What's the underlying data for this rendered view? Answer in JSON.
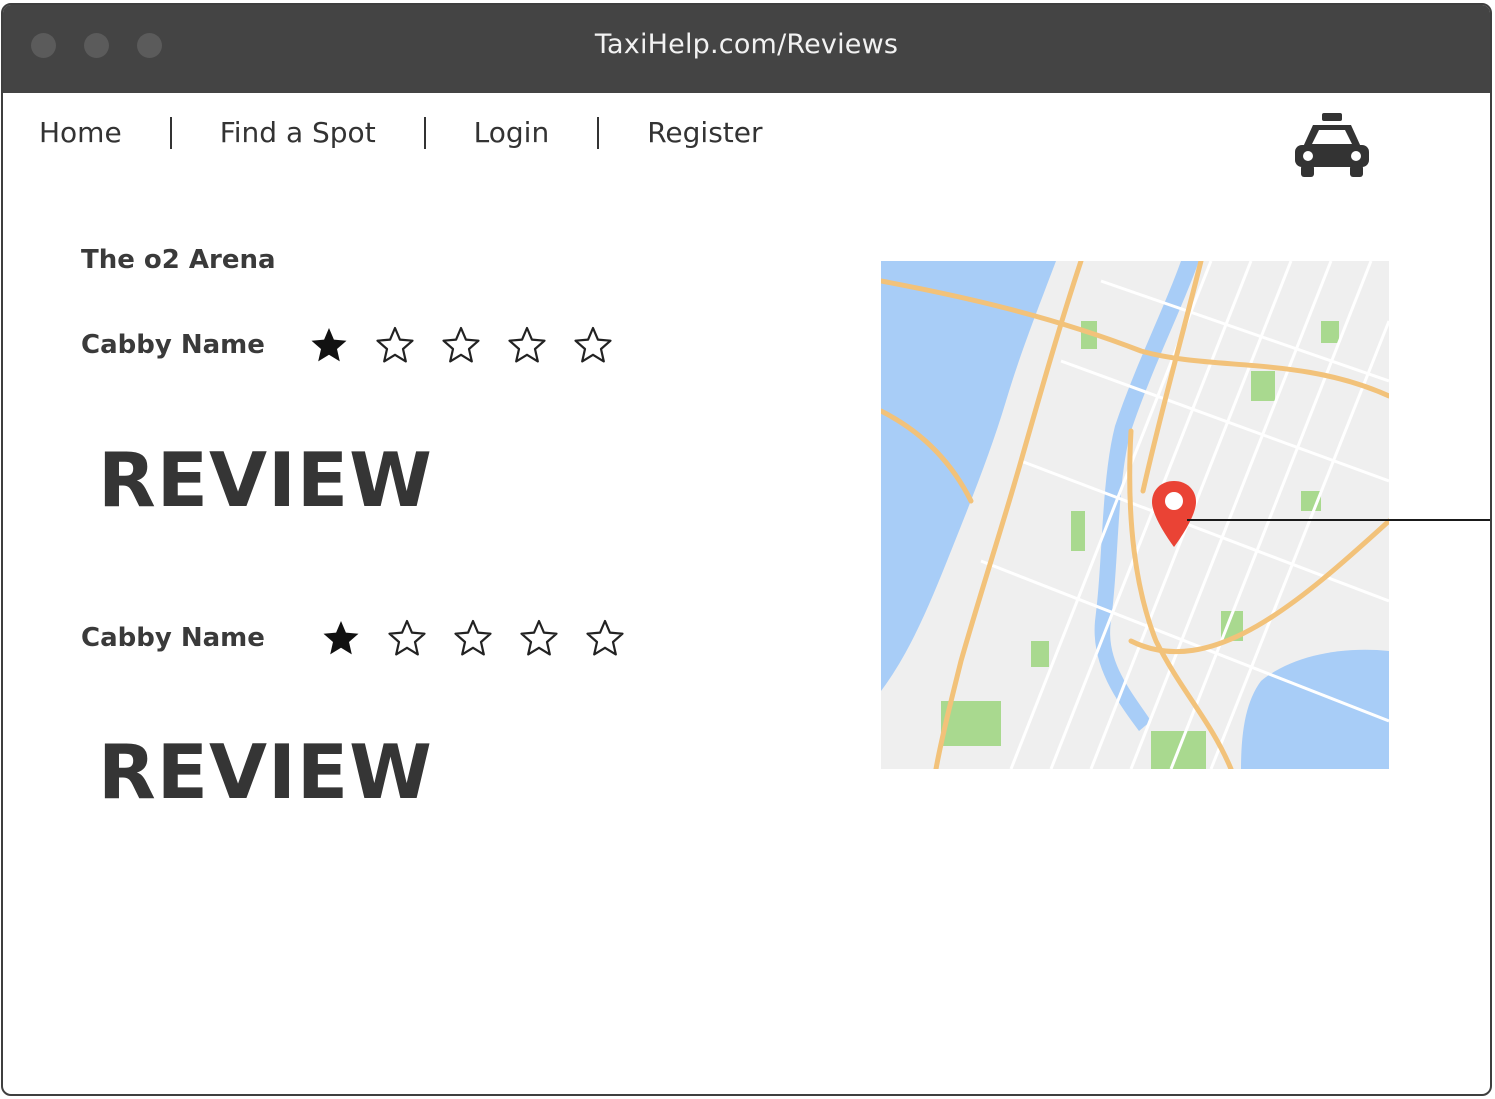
{
  "window": {
    "title": "TaxiHelp.com/Reviews"
  },
  "nav": {
    "items": [
      {
        "label": "Home"
      },
      {
        "label": "Find a Spot"
      },
      {
        "label": "Login"
      },
      {
        "label": "Register"
      }
    ]
  },
  "page": {
    "location_name": "The o2 Arena",
    "reviews": [
      {
        "cabby_name": "Cabby Name",
        "rating": 1,
        "max_rating": 5,
        "text": "REVIEW"
      },
      {
        "cabby_name": "Cabby Name",
        "rating": 1,
        "max_rating": 5,
        "text": "REVIEW"
      }
    ]
  },
  "icons": {
    "logo": "taxi-icon",
    "map_marker": "map-pin-icon",
    "star_filled": "star-filled-icon",
    "star_empty": "star-empty-icon"
  },
  "colors": {
    "titlebar": "#444444",
    "text": "#333333",
    "marker": "#ea4335",
    "water": "#a8cdf7",
    "park": "#a9d98f",
    "road": "#f2c27a"
  }
}
